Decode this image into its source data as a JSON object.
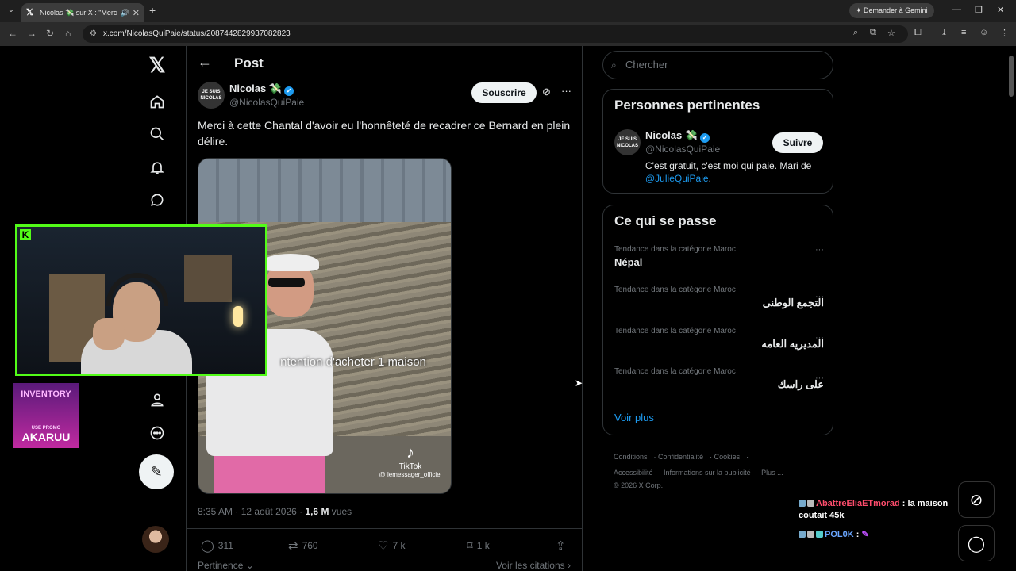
{
  "browser": {
    "tab_title": "Nicolas 💸 sur X : \"Merci à",
    "url": "x.com/NicolasQuiPaie/status/2087442829937082823",
    "gemini_label": "Demander à Gemini"
  },
  "post": {
    "header_title": "Post",
    "author_name": "Nicolas 💸",
    "author_handle": "@NicolasQuiPaie",
    "avatar_text": "JE SUIS NICOLAS",
    "subscribe_label": "Souscrire",
    "text": "Merci à cette Chantal d'avoir eu l'honnêteté de recadrer ce Bernard en plein délire.",
    "video_caption": "ntention d'acheter 1 maison",
    "tiktok_label": "TikTok",
    "tiktok_handle": "@ lemessager_officiel",
    "timestamp": "8:35 AM · 12 août 2026 · ",
    "views_count": "1,6 M",
    "views_label": " vues",
    "replies": "311",
    "reposts": "760",
    "likes": "7 k",
    "bookmarks": "1 k",
    "sort_label": "Pertinence",
    "quotes_label": "Voir les citations"
  },
  "search": {
    "placeholder": "Chercher"
  },
  "relevant": {
    "title": "Personnes pertinentes",
    "name": "Nicolas 💸",
    "handle": "@NicolasQuiPaie",
    "follow_label": "Suivre",
    "bio": "C'est gratuit, c'est moi qui paie. Mari de ",
    "bio_mention": "@JulieQuiPaie",
    "bio_end": "."
  },
  "trends": {
    "title": "Ce qui se passe",
    "items": [
      {
        "category": "Tendance dans la catégorie Maroc",
        "name": "Népal",
        "rtl": false
      },
      {
        "category": "Tendance dans la catégorie Maroc",
        "name": "التجمع الوطنى",
        "rtl": true
      },
      {
        "category": "Tendance dans la catégorie Maroc",
        "name": "المديريه العامه",
        "rtl": true
      },
      {
        "category": "Tendance dans la catégorie Maroc",
        "name": "على راسك",
        "rtl": true
      }
    ],
    "more_label": "Voir plus"
  },
  "footer": {
    "conditions": "Conditions",
    "privacy": "Confidentialité",
    "cookies": "Cookies",
    "accessibility": "Accessibilité",
    "ads": "Informations sur la publicité",
    "more": "Plus ...",
    "copyright": "© 2026 X Corp."
  },
  "overlay": {
    "promo_top": "INVENTORY",
    "promo_use": "USE PROMO",
    "promo_code": "AKARUU",
    "chat": [
      {
        "user": "AbattreEliaETmorad",
        "text": " : la maison coutait 45k"
      },
      {
        "user": "POL0K",
        "text": " : "
      }
    ]
  }
}
